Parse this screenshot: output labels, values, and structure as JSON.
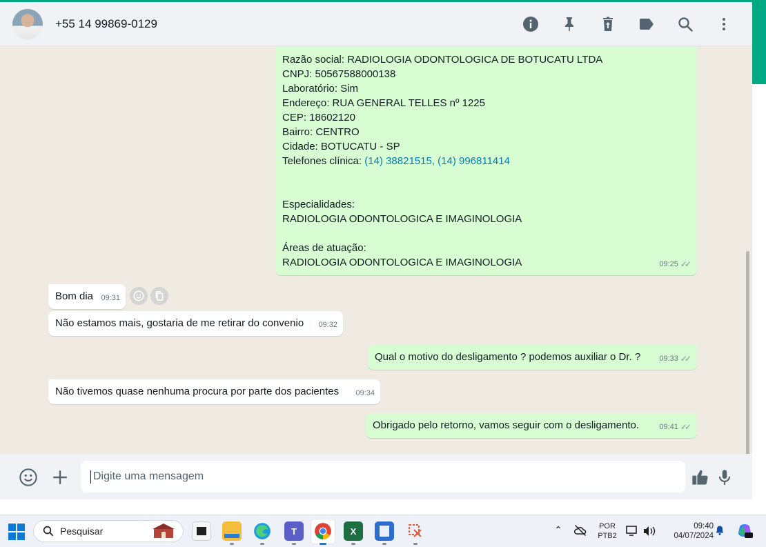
{
  "header": {
    "contact_name": "+55 14 99869-0129",
    "icons": [
      "info-icon",
      "pin-icon",
      "delete-icon",
      "label-icon",
      "search-icon",
      "menu-icon"
    ]
  },
  "chat": {
    "clinic_message": {
      "lines": [
        "Razão social: RADIOLOGIA ODONTOLOGICA DE BOTUCATU LTDA",
        "CNPJ: 50567588000138",
        "Laboratório: Sim",
        "Endereço: RUA GENERAL TELLES nº 1225",
        "CEP: 18602120",
        "Bairro: CENTRO",
        "Cidade: BOTUCATU - SP"
      ],
      "phones_label": "Telefones clínica: ",
      "phones_links": "(14) 38821515, (14) 996811414",
      "specialties_label": "Especialidades:",
      "specialties_value": "RADIOLOGIA ODONTOLOGICA E IMAGINOLOGIA",
      "areas_label": "Áreas de atuação:",
      "areas_value": "RADIOLOGIA ODONTOLOGICA E IMAGINOLOGIA",
      "time": "09:25"
    },
    "messages": [
      {
        "text": "Bom dia",
        "time": "09:31",
        "direction": "incoming"
      },
      {
        "text": "Não estamos mais, gostaria de me retirar do convenio",
        "time": "09:32",
        "direction": "incoming"
      },
      {
        "text": "Qual o motivo do desligamento ? podemos auxiliar o Dr. ?",
        "time": "09:33",
        "direction": "outgoing"
      },
      {
        "text": "Não tivemos quase nenhuma procura por parte dos pacientes",
        "time": "09:34",
        "direction": "incoming"
      },
      {
        "text": "Obrigado pelo retorno, vamos seguir com o desligamento.",
        "time": "09:41",
        "direction": "outgoing"
      }
    ]
  },
  "composer": {
    "placeholder": "Digite uma mensagem"
  },
  "taskbar": {
    "search_label": "Pesquisar",
    "lang_top": "POR",
    "lang_bottom": "PTB2",
    "clock_time": "09:40",
    "clock_date": "04/07/2024"
  },
  "colors": {
    "accent": "#00a884",
    "outgoing_bubble": "#d9fdd3",
    "incoming_bubble": "#ffffff",
    "link": "#027eb5",
    "chat_bg": "#efeae2"
  }
}
